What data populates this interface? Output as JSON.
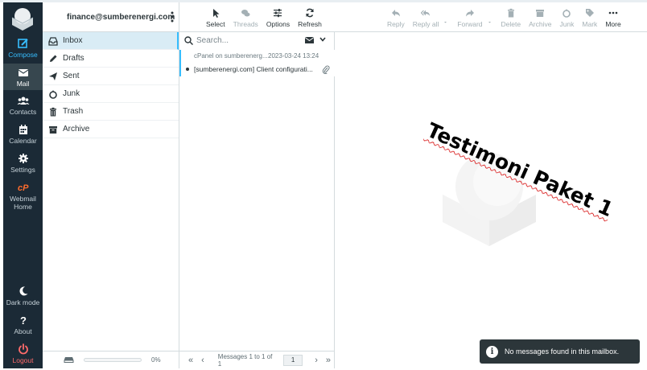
{
  "nav": {
    "compose": "Compose",
    "mail": "Mail",
    "contacts": "Contacts",
    "calendar": "Calendar",
    "settings": "Settings",
    "webmail_1": "Webmail",
    "webmail_2": "Home",
    "dark_mode": "Dark mode",
    "about": "About",
    "logout": "Logout"
  },
  "account": {
    "email": "finance@sumberenergi.com"
  },
  "folders": [
    {
      "label": "Inbox"
    },
    {
      "label": "Drafts"
    },
    {
      "label": "Sent"
    },
    {
      "label": "Junk"
    },
    {
      "label": "Trash"
    },
    {
      "label": "Archive"
    }
  ],
  "quota": {
    "percent_label": "0%",
    "used_fraction": 0
  },
  "list_toolbar": {
    "select": "Select",
    "threads": "Threads",
    "options": "Options",
    "refresh": "Refresh"
  },
  "message_toolbar": {
    "reply": "Reply",
    "reply_all": "Reply all",
    "forward": "Forward",
    "delete": "Delete",
    "archive": "Archive",
    "junk": "Junk",
    "mark": "Mark",
    "more": "More"
  },
  "search": {
    "placeholder": "Search..."
  },
  "messages": [
    {
      "from": "cPanel on sumberenerg...",
      "date": "2023-03-24 13:24",
      "subject": "[sumberenergi.com] Client configurati..."
    }
  ],
  "pager": {
    "text": "Messages 1 to 1 of 1",
    "page": "1"
  },
  "watermark": "Testimoni Paket 1",
  "toast": {
    "text": "No messages found in this mailbox."
  },
  "colors": {
    "accent": "#37beff",
    "nav_bg": "#1b2a36",
    "logout": "#ff6b6b"
  }
}
